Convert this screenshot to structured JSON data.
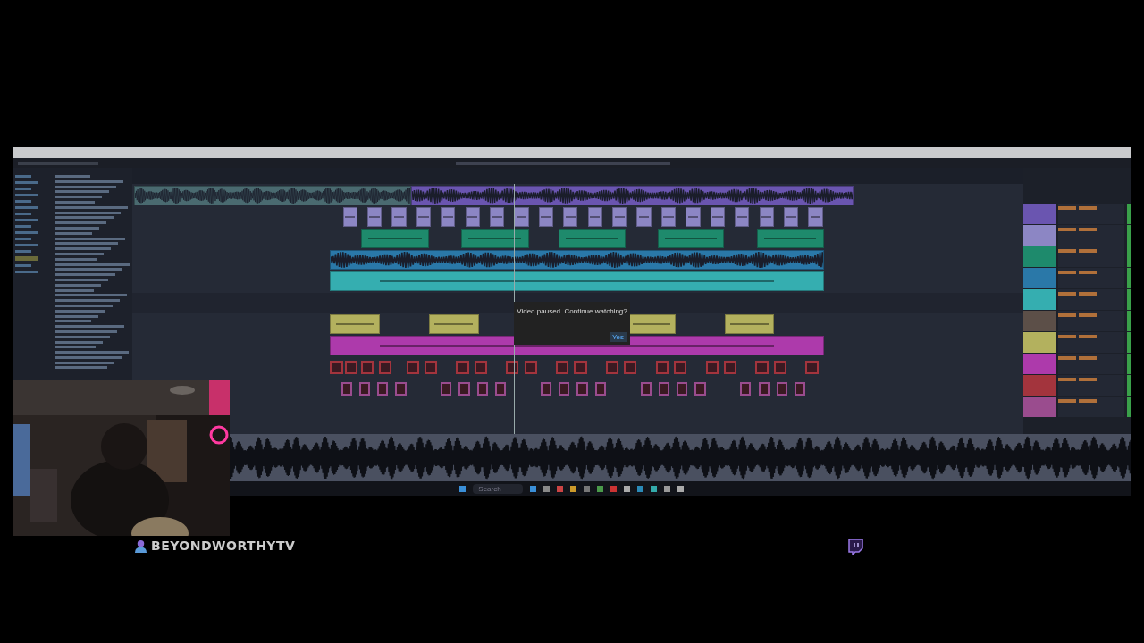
{
  "dialog": {
    "message": "Video paused. Continue watching?",
    "button": "Yes"
  },
  "taskbar": {
    "search": {
      "placeholder": "Search"
    }
  },
  "tracks": [
    {
      "kind": "audio",
      "color": "#6a55b0"
    },
    {
      "kind": "midi",
      "color": "#8c86c4"
    },
    {
      "kind": "midi",
      "color": "#1e8a6c"
    },
    {
      "kind": "audio",
      "color": "#2a78a8"
    },
    {
      "kind": "midi",
      "color": "#35aeb0"
    },
    {
      "kind": "empty",
      "color": "#5c4f48"
    },
    {
      "kind": "midi",
      "color": "#b3b15e"
    },
    {
      "kind": "midi",
      "color": "#ad3aab"
    },
    {
      "kind": "notes",
      "color": "#a3343d"
    },
    {
      "kind": "notes",
      "color": "#9a4c8e"
    }
  ],
  "streamer": {
    "name": "BEYONDWORTHYTV"
  }
}
